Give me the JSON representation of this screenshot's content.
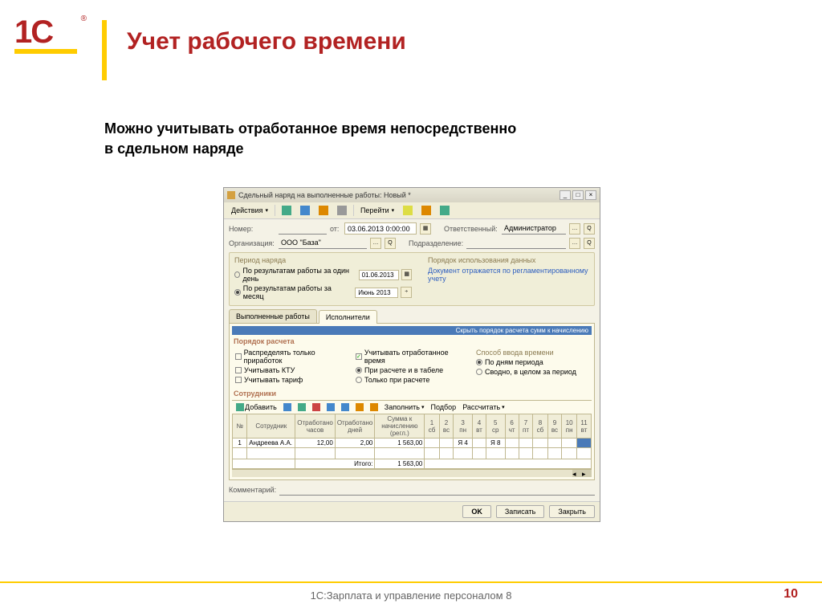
{
  "slide": {
    "title": "Учет рабочего времени",
    "subtitle_line1": "Можно учитывать отработанное время непосредственно",
    "subtitle_line2": "в сдельном наряде",
    "footer": "1С:Зарплата и управление персоналом 8",
    "page": "10",
    "logo": "1С"
  },
  "window": {
    "title": "Сдельный наряд на выполненные работы: Новый *",
    "toolbar": {
      "actions": "Действия",
      "goto": "Перейти"
    },
    "form": {
      "number_label": "Номер:",
      "from_label": "от:",
      "date_value": "03.06.2013 0:00:00",
      "responsible_label": "Ответственный:",
      "responsible_value": "Администратор",
      "org_label": "Организация:",
      "org_value": "ООО \"База\"",
      "division_label": "Подразделение:"
    },
    "period_group": {
      "title": "Период наряда",
      "opt_day": "По результатам работы за один день",
      "opt_month": "По результатам работы за месяц",
      "day_value": "01.06.2013",
      "month_value": "Июнь 2013",
      "usage_title": "Порядок использования данных",
      "usage_link": "Документ отражается по регламентированному учету"
    },
    "tabs": {
      "works": "Выполненные работы",
      "performers": "Исполнители"
    },
    "blue_bar": "Скрыть порядок расчета сумм к начислению",
    "calc": {
      "title": "Порядок расчета",
      "col1_opt1": "Распределять только приработок",
      "col1_opt2": "Учитывать КТУ",
      "col1_opt3": "Учитывать тариф",
      "col2_opt1": "Учитывать отработанное время",
      "col2_opt2": "При расчете и в табеле",
      "col2_opt3": "Только при расчете",
      "col3_title": "Способ ввода времени",
      "col3_opt1": "По дням периода",
      "col3_opt2": "Сводно, в целом за период"
    },
    "employees_title": "Сотрудники",
    "grid_toolbar": {
      "add": "Добавить",
      "fill": "Заполнить",
      "select": "Подбор",
      "calc": "Рассчитать"
    },
    "table": {
      "headers": {
        "num": "№",
        "employee": "Сотрудник",
        "hours": "Отработано часов",
        "days": "Отработано дней",
        "sum": "Сумма к начислению (регл.)"
      },
      "days_header": [
        {
          "n": "1",
          "d": "сб",
          "red": true
        },
        {
          "n": "2",
          "d": "вс",
          "red": true
        },
        {
          "n": "3",
          "d": "пн"
        },
        {
          "n": "4",
          "d": "вт"
        },
        {
          "n": "5",
          "d": "ср"
        },
        {
          "n": "6",
          "d": "чт"
        },
        {
          "n": "7",
          "d": "пт"
        },
        {
          "n": "8",
          "d": "сб",
          "red": true
        },
        {
          "n": "9",
          "d": "вс",
          "red": true
        },
        {
          "n": "10",
          "d": "пн"
        },
        {
          "n": "11",
          "d": "вт"
        }
      ],
      "row": {
        "num": "1",
        "employee": "Андреева А.А.",
        "hours": "12,00",
        "days": "2,00",
        "sum": "1 563,00",
        "d3": "Я 4",
        "d5": "Я 8"
      },
      "total_label": "Итого:",
      "total_sum": "1 563,00"
    },
    "comment_label": "Комментарий:",
    "buttons": {
      "ok": "OK",
      "save": "Записать",
      "close": "Закрыть"
    }
  }
}
